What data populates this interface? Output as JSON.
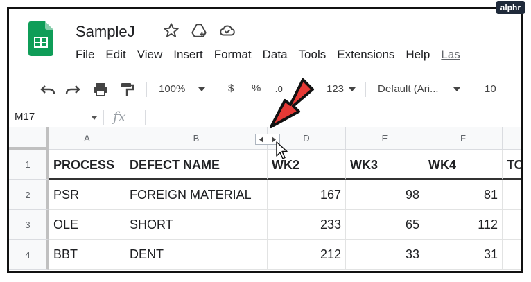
{
  "watermark": "alphr",
  "app": {
    "doc_title": "SampleJ"
  },
  "menu": [
    "File",
    "Edit",
    "View",
    "Insert",
    "Format",
    "Data",
    "Tools",
    "Extensions",
    "Help",
    "Las"
  ],
  "toolbar": {
    "zoom": "100%",
    "currency": "$",
    "percent": "%",
    "decimal_dec": ".0",
    "decimal_inc": ".00",
    "more_formats": "123",
    "font": "Default (Ari...",
    "font_size": "10"
  },
  "formula_bar": {
    "cell_ref": "M17",
    "fx": "fx"
  },
  "columns": [
    "A",
    "B",
    "",
    "D",
    "E",
    "F",
    ""
  ],
  "rows": [
    {
      "num": "1",
      "cells": [
        "PROCESS",
        "DEFECT NAME",
        "WK2",
        "WK3",
        "WK4",
        "TO"
      ]
    },
    {
      "num": "2",
      "cells": [
        "PSR",
        "FOREIGN MATERIAL",
        "167",
        "98",
        "81",
        ""
      ]
    },
    {
      "num": "3",
      "cells": [
        "OLE",
        "SHORT",
        "233",
        "65",
        "112",
        ""
      ]
    },
    {
      "num": "4",
      "cells": [
        "BBT",
        "DENT",
        "212",
        "33",
        "31",
        ""
      ]
    }
  ],
  "colors": {
    "sheets_green": "#0f9d58",
    "arrow_red": "#e53935"
  }
}
